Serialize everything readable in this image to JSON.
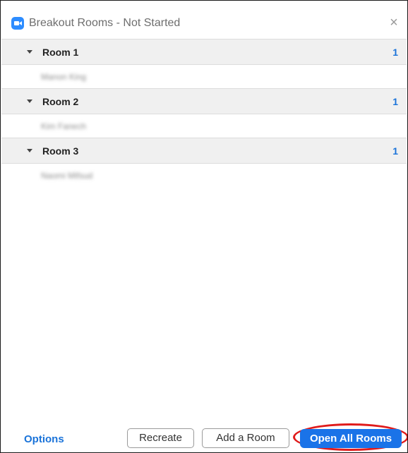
{
  "window": {
    "title": "Breakout Rooms - Not Started",
    "close_glyph": "×"
  },
  "rooms": [
    {
      "name": "Room 1",
      "count": "1",
      "participant": "Manon King"
    },
    {
      "name": "Room 2",
      "count": "1",
      "participant": "Kim Fanech"
    },
    {
      "name": "Room 3",
      "count": "1",
      "participant": "Naomi Mifsud"
    }
  ],
  "footer": {
    "options_label": "Options",
    "recreate_label": "Recreate",
    "add_room_label": "Add a Room",
    "open_all_label": "Open All Rooms"
  },
  "colors": {
    "accent": "#1a73e8",
    "link": "#1a73d9",
    "highlight": "#e01b1b",
    "header_bg": "#f0f0f0"
  },
  "icons": {
    "app": "zoom-camera-icon",
    "close": "close-icon",
    "caret": "caret-down-icon"
  }
}
